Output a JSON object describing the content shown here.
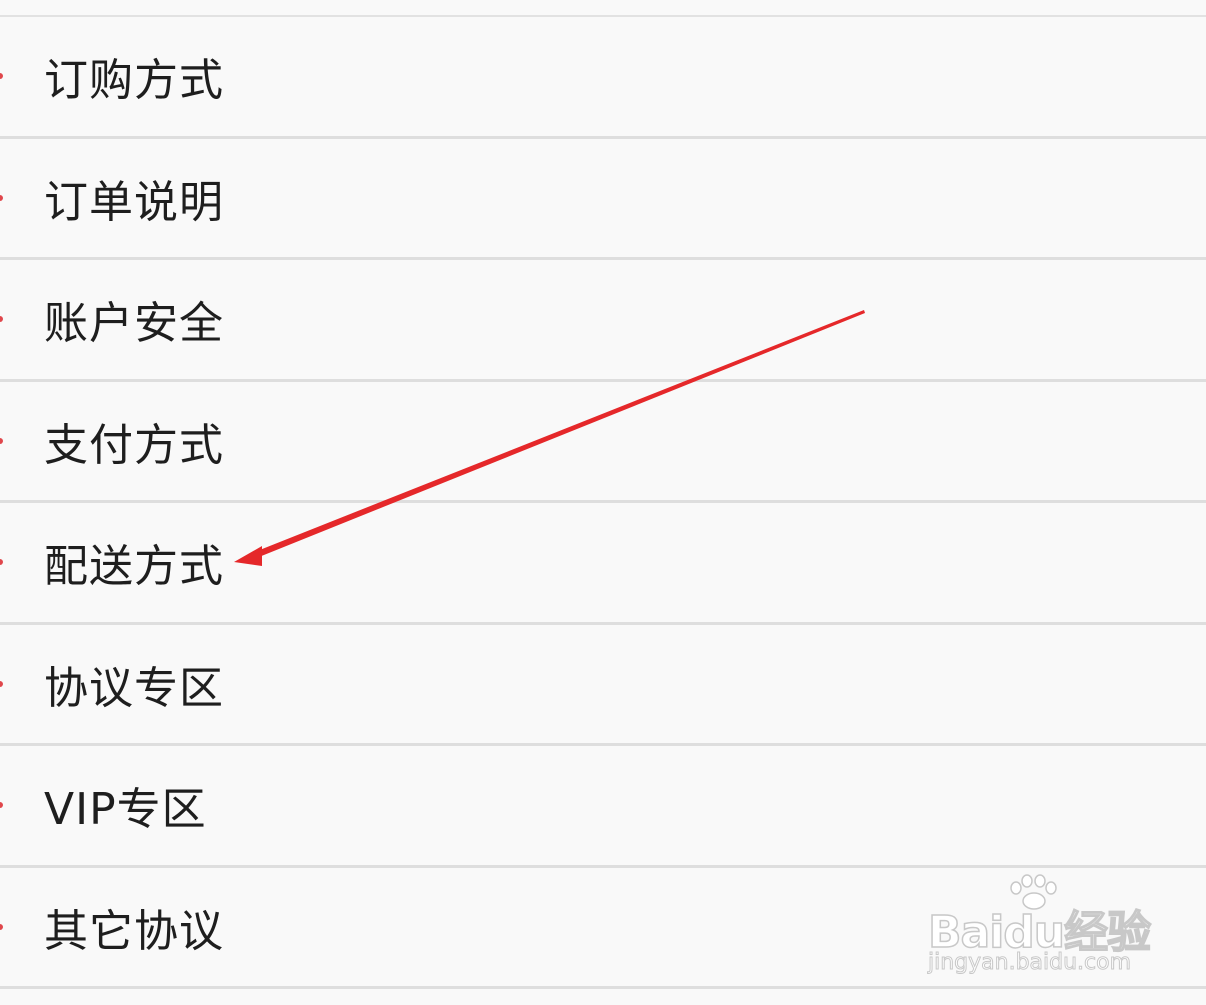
{
  "menu": {
    "items": [
      {
        "label": "订购方式"
      },
      {
        "label": "订单说明"
      },
      {
        "label": "账户安全"
      },
      {
        "label": "支付方式"
      },
      {
        "label": "配送方式"
      },
      {
        "label": "协议专区"
      },
      {
        "label": "VIP专区"
      },
      {
        "label": "其它协议"
      }
    ]
  },
  "colors": {
    "bullet": "#e0474c",
    "arrow": "#e5282a",
    "divider": "#dedede",
    "text": "#1e1e1e",
    "background": "#f9f9f9"
  },
  "watermark": {
    "brand": "Baidu经验",
    "url": "jingyan.baidu.com"
  }
}
